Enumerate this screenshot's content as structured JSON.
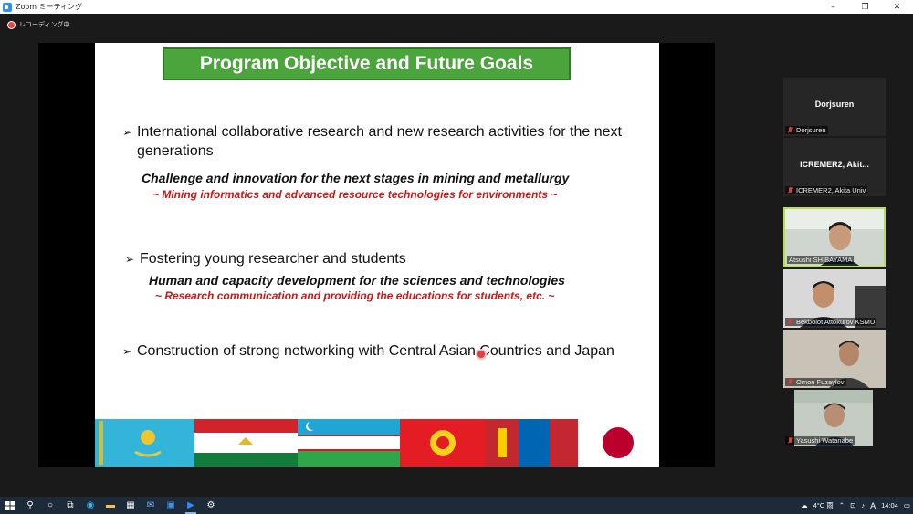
{
  "window": {
    "title": "Zoom ミーティング",
    "minimize": "–",
    "restore": "❐",
    "close": "✕"
  },
  "recording": {
    "label": "レコーディング中"
  },
  "slide": {
    "title": "Program Objective and Future Goals",
    "bullets": [
      {
        "text": "International collaborative research and new research activities for the next generations",
        "sub": "Challenge and innovation for the next stages in mining and metallurgy",
        "sub_red": "~ Mining informatics and advanced resource technologies for environments ~"
      },
      {
        "text": "Fostering young researcher and students",
        "sub": "Human and capacity development for the sciences and technologies",
        "sub_red": "~ Research communication and providing the educations for students, etc. ~"
      },
      {
        "text": "Construction of strong networking with Central Asian Countries and Japan"
      }
    ],
    "flags": [
      "kazakhstan-flag",
      "tajikistan-flag",
      "uzbekistan-flag",
      "kyrgyzstan-flag",
      "mongolia-flag",
      "japan-flag"
    ]
  },
  "participants": [
    {
      "display": "Dorjsuren",
      "name": "Dorjsuren",
      "video": false
    },
    {
      "display": "ICREMER2, Akit...",
      "name": "ICREMER2, Akita Univ",
      "video": false
    },
    {
      "display": "",
      "name": "Atsushi SHIBAYAMA",
      "video": true,
      "active": true
    },
    {
      "display": "",
      "name": "Bekbolot Attokurov KSMU",
      "video": true
    },
    {
      "display": "",
      "name": "Omon Fuzaylov",
      "video": true
    },
    {
      "display": "",
      "name": "Yasushi Watanabe",
      "video": true
    }
  ],
  "taskbar": {
    "weather": "4°C 雨",
    "ime": "A",
    "time": "14:04",
    "colors": {
      "bg": "#1c2a3a"
    }
  }
}
